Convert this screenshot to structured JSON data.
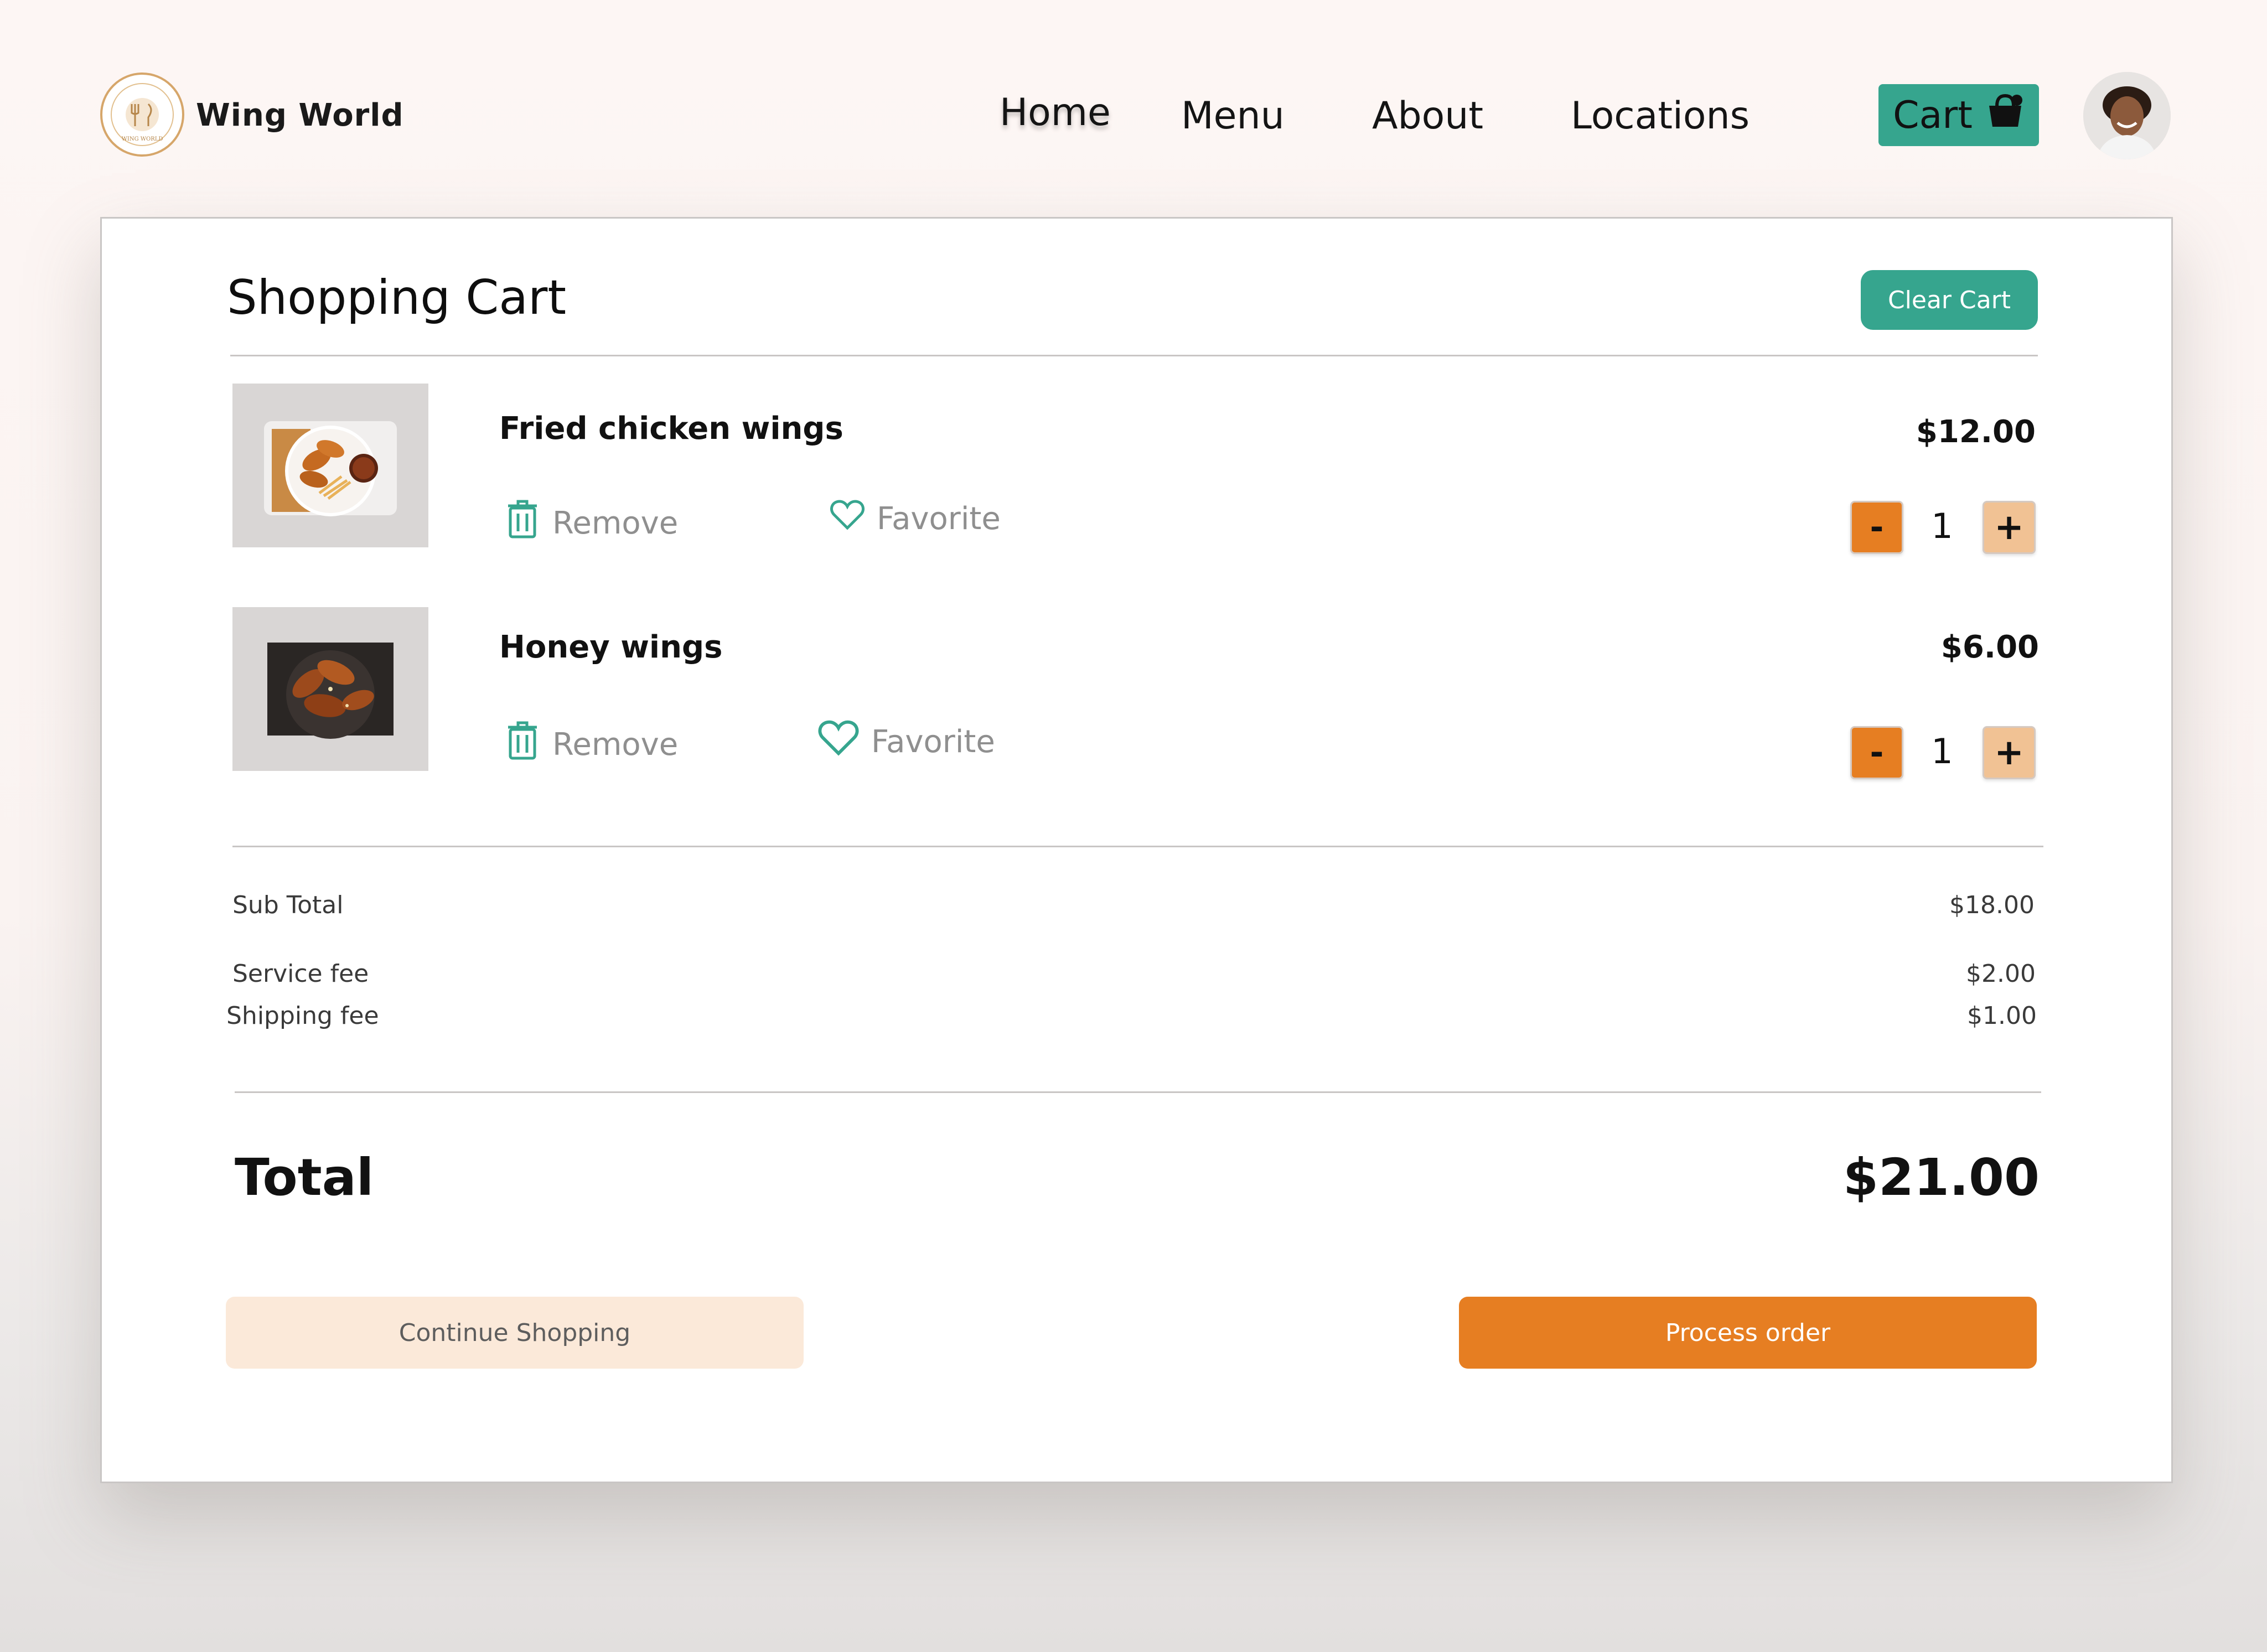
{
  "header": {
    "brand": "Wing World",
    "nav": [
      "Home",
      "Menu",
      "About",
      "Locations"
    ],
    "cart_label": "Cart",
    "avatar_icon": "user-avatar"
  },
  "cart": {
    "title": "Shopping Cart",
    "clear_label": "Clear Cart",
    "items": [
      {
        "name": "Fried chicken wings",
        "price": "$12.00",
        "quantity": "1",
        "remove_label": "Remove",
        "favorite_label": "Favorite"
      },
      {
        "name": "Honey wings",
        "price": "$6.00",
        "quantity": "1",
        "remove_label": "Remove",
        "favorite_label": "Favorite"
      }
    ],
    "decrement_symbol": "-",
    "increment_symbol": "+"
  },
  "summary": {
    "subtotal_label": "Sub Total",
    "subtotal": "$18.00",
    "service_label": "Service fee",
    "service": "$2.00",
    "shipping_label": "Shipping fee",
    "shipping": "$1.00",
    "total_label": "Total",
    "total": "$21.00"
  },
  "actions": {
    "continue_label": "Continue Shopping",
    "process_label": "Process order"
  },
  "colors": {
    "accent_teal": "#36a58e",
    "accent_orange": "#e67e22",
    "peach": "#f1c294",
    "light_peach": "#fbe9d9"
  }
}
